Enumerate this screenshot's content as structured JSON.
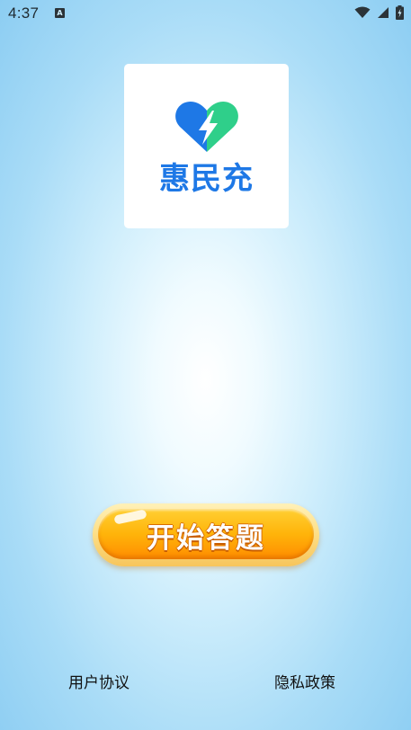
{
  "status_bar": {
    "time": "4:37",
    "notification_badge": "A",
    "icons": [
      "wifi-icon",
      "signal-icon",
      "battery-icon"
    ]
  },
  "logo": {
    "app_name": "惠民充",
    "icon": "heart-lightning-icon",
    "colors": {
      "heart_left": "#1e78e6",
      "heart_right": "#2fcf8a",
      "text": "#1e78e6"
    }
  },
  "start_button": {
    "label": "开始答题",
    "color": "#ffb40a"
  },
  "footer": {
    "user_agreement": "用户协议",
    "privacy_policy": "隐私政策"
  }
}
